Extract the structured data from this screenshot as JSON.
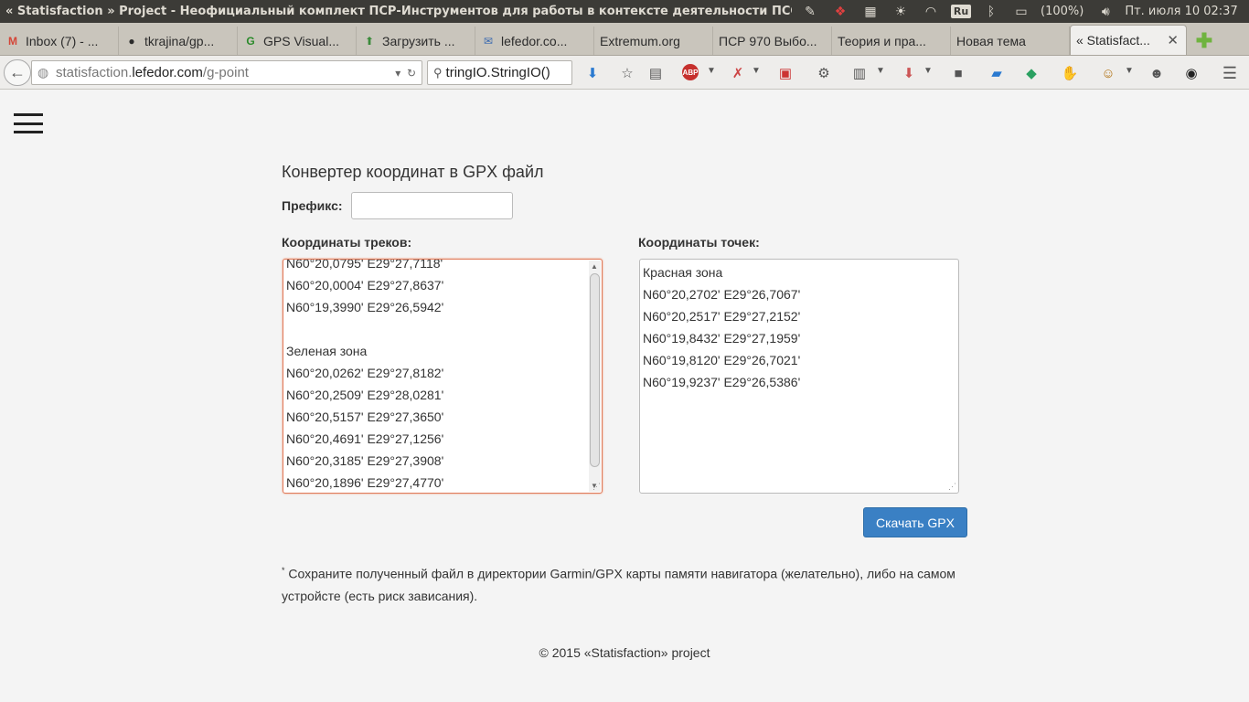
{
  "topbar": {
    "window_title": "« Statisfaction » Project - Неофициальный комплект ПСР-Инструментов для работы в контексте деятельности ПСО",
    "keyboard_layout": "Ru",
    "battery": "(100%)",
    "datetime": "Пт. июля 10 02:37"
  },
  "tabs": [
    {
      "label": "Inbox (7) - ...",
      "icon": "gmail-icon"
    },
    {
      "label": "tkrajina/gp...",
      "icon": "github-icon"
    },
    {
      "label": "GPS Visual...",
      "icon": "gpsvisualizer-icon"
    },
    {
      "label": "Загрузить ...",
      "icon": "upload-icon"
    },
    {
      "label": "lefedor.co...",
      "icon": "mail-icon"
    },
    {
      "label": "Extremum.org",
      "icon": "none"
    },
    {
      "label": "ПСР 970 Выбо...",
      "icon": "none"
    },
    {
      "label": "Теория и пра...",
      "icon": "none"
    },
    {
      "label": "Новая тема",
      "icon": "none"
    },
    {
      "label": "« Statisfact...",
      "icon": "none",
      "active": true
    }
  ],
  "navbar": {
    "url_prefix": "statisfaction.",
    "url_domain": "lefedor.com",
    "url_path": "/g-point",
    "search_value": "tringIO.StringIO()"
  },
  "page": {
    "title": "Конвертер координат в GPX файл",
    "prefix_label": "Префикс:",
    "prefix_value": "",
    "tracks_label": "Координаты треков:",
    "points_label": "Координаты точек:",
    "tracks_text": "N60°20,0795' E29°27,7118'\nN60°20,0004' E29°27,8637'\nN60°19,3990' E29°26,5942'\n\nЗеленая зона\nN60°20,0262' E29°27,8182'\nN60°20,2509' E29°28,0281'\nN60°20,5157' E29°27,3650'\nN60°20,4691' E29°27,1256'\nN60°20,3185' E29°27,3908'\nN60°20,1896' E29°27,4770'",
    "points_text": "Красная зона\nN60°20,2702' E29°26,7067'\nN60°20,2517' E29°27,2152'\nN60°19,8432' E29°27,1959'\nN60°19,8120' E29°26,7021'\nN60°19,9237' E29°26,5386'",
    "download_label": "Скачать GPX",
    "note_mark": "*",
    "note_text": " Сохраните полученный файл в директории Garmin/GPX карты памяти навигатора (желательно), либо на самом устройсте (есть риск зависания).",
    "footer": "© 2015 «Statisfaction» project"
  }
}
